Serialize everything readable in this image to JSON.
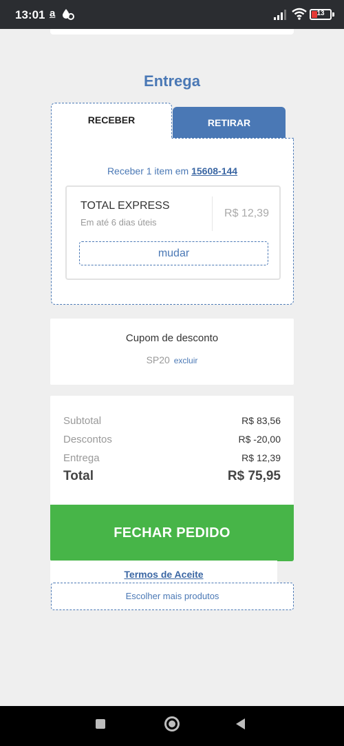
{
  "status_bar": {
    "time": "13:01",
    "notification_icon": "a",
    "battery": "13"
  },
  "delivery": {
    "title": "Entrega",
    "tabs": [
      {
        "label": "RECEBER",
        "active": true
      },
      {
        "label": "RETIRAR",
        "active": false
      }
    ],
    "receive_prefix": "Receber 1 item em ",
    "zip_code": "15608-144",
    "shipping": {
      "name": "TOTAL EXPRESS",
      "time": "Em até 6 dias úteis",
      "price": "R$ 12,39"
    },
    "change_label": "mudar"
  },
  "coupon": {
    "title": "Cupom de desconto",
    "code": "SP20",
    "remove_label": "excluir"
  },
  "summary": {
    "subtotal_label": "Subtotal",
    "subtotal_value": "R$ 83,56",
    "discount_label": "Descontos",
    "discount_value": "R$ -20,00",
    "shipping_label": "Entrega",
    "shipping_value": "R$ 12,39",
    "total_label": "Total",
    "total_value": "R$ 75,95"
  },
  "actions": {
    "checkout_label": "FECHAR PEDIDO",
    "terms_label": "Termos de Aceite",
    "more_products_label": "Escolher mais produtos"
  },
  "colors": {
    "accent_blue": "#4a78b5",
    "checkout_green": "#47b548",
    "background": "#efefef",
    "status_bar": "#2b2d31"
  },
  "icons": [
    "drop-icon",
    "signal-icon",
    "wifi-icon",
    "battery-icon",
    "recents-icon",
    "home-icon",
    "back-icon"
  ]
}
